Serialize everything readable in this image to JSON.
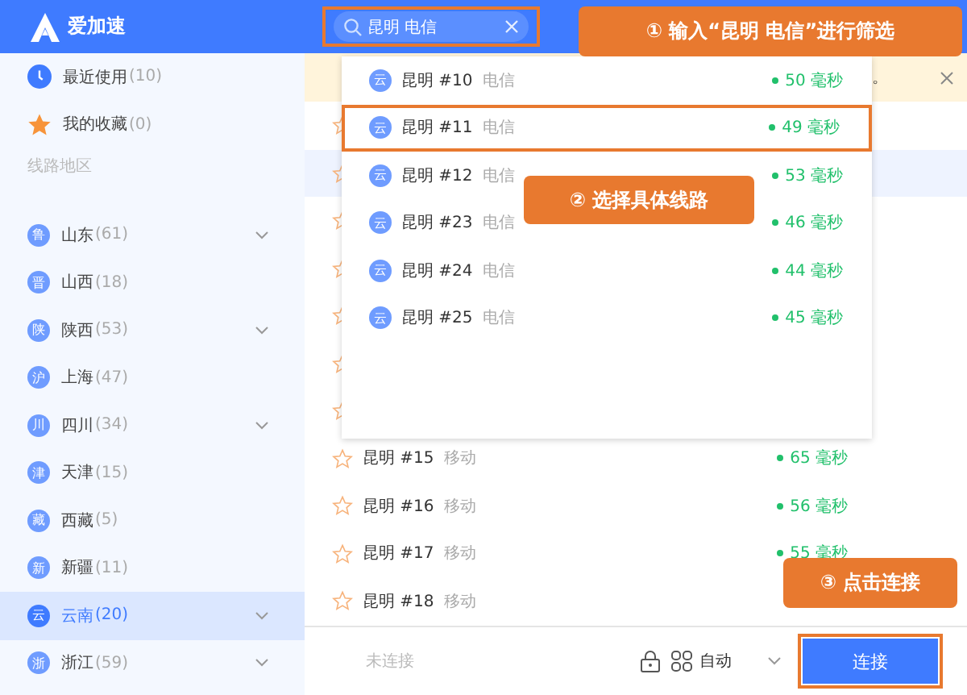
{
  "app": {
    "name": "爱加速"
  },
  "sidebar": {
    "items": [
      {
        "kind": "recent",
        "label": "最近使用",
        "count": "(10)",
        "selected": false
      },
      {
        "kind": "favorites",
        "label": "我的收藏",
        "count": "(0)",
        "selected": false
      }
    ],
    "section_title": "线路地区",
    "regions": [
      {
        "badge": "鲁",
        "label": "山东",
        "count": "(61)",
        "expandable": true,
        "selected": false
      },
      {
        "badge": "晋",
        "label": "山西",
        "count": "(18)",
        "expandable": false,
        "selected": false
      },
      {
        "badge": "陕",
        "label": "陕西",
        "count": "(53)",
        "expandable": true,
        "selected": false
      },
      {
        "badge": "沪",
        "label": "上海",
        "count": "(47)",
        "expandable": false,
        "selected": false
      },
      {
        "badge": "川",
        "label": "四川",
        "count": "(34)",
        "expandable": true,
        "selected": false
      },
      {
        "badge": "津",
        "label": "天津",
        "count": "(15)",
        "expandable": false,
        "selected": false
      },
      {
        "badge": "藏",
        "label": "西藏",
        "count": "(5)",
        "expandable": false,
        "selected": false
      },
      {
        "badge": "新",
        "label": "新疆",
        "count": "(11)",
        "expandable": false,
        "selected": false
      },
      {
        "badge": "云",
        "label": "云南",
        "count": "(20)",
        "expandable": true,
        "selected": true
      },
      {
        "badge": "浙",
        "label": "浙江",
        "count": "(59)",
        "expandable": true,
        "selected": false
      }
    ]
  },
  "search": {
    "value": "昆明 电信"
  },
  "notice": {
    "tail": "。"
  },
  "hidden_rows": [
    {
      "highlighted": false
    },
    {
      "highlighted": true
    },
    {
      "highlighted": false
    },
    {
      "highlighted": false
    },
    {
      "highlighted": false
    },
    {
      "highlighted": false
    },
    {
      "highlighted": false
    }
  ],
  "rows": [
    {
      "name": "昆明 #15",
      "carrier": "移动",
      "latency": "65 毫秒"
    },
    {
      "name": "昆明 #16",
      "carrier": "移动",
      "latency": "56 毫秒"
    },
    {
      "name": "昆明 #17",
      "carrier": "移动",
      "latency": "55 毫秒"
    },
    {
      "name": "昆明 #18",
      "carrier": "移动"
    }
  ],
  "dropdown": {
    "results": [
      {
        "badge": "云",
        "name": "昆明 #10",
        "carrier": "电信",
        "latency": "50 毫秒",
        "selected": false
      },
      {
        "badge": "云",
        "name": "昆明 #11",
        "carrier": "电信",
        "latency": "49 毫秒",
        "selected": true
      },
      {
        "badge": "云",
        "name": "昆明 #12",
        "carrier": "电信",
        "latency": "53 毫秒",
        "selected": false
      },
      {
        "badge": "云",
        "name": "昆明 #23",
        "carrier": "电信",
        "latency": "46 毫秒",
        "selected": false
      },
      {
        "badge": "云",
        "name": "昆明 #24",
        "carrier": "电信",
        "latency": "44 毫秒",
        "selected": false
      },
      {
        "badge": "云",
        "name": "昆明 #25",
        "carrier": "电信",
        "latency": "45 毫秒",
        "selected": false
      }
    ]
  },
  "status_bar": {
    "status": "未连接",
    "mode": "自动",
    "connect_button": "连接"
  },
  "callouts": [
    "① 输入“昆明 电信”进行筛选",
    "② 选择具体线路",
    "③ 点击连接"
  ]
}
